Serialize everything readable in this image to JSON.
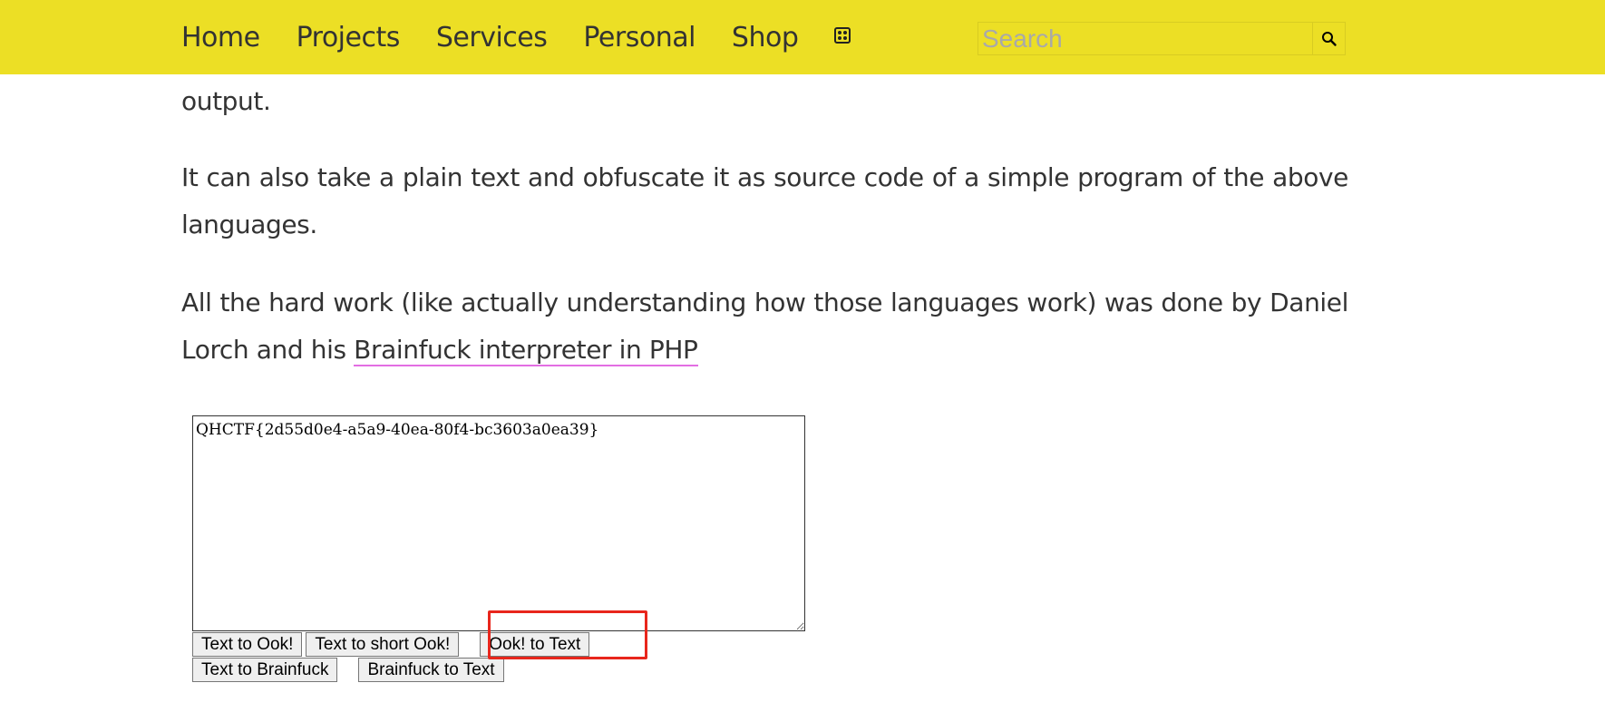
{
  "nav": {
    "items": [
      "Home",
      "Projects",
      "Services",
      "Personal",
      "Shop"
    ],
    "random_icon": "dice-icon"
  },
  "search": {
    "placeholder": "Search",
    "value": "",
    "button_icon": "search-icon"
  },
  "content": {
    "p1": "output.",
    "p2": "It can also take a plain text and obfuscate it as source code of a simple program of the above languages.",
    "p3_text": "All the hard work (like actually understanding how those languages work) was done by Daniel Lorch and his ",
    "p3_link": "Brainfuck interpreter in PHP"
  },
  "tool": {
    "textarea_value": "QHCTF{2d55d0e4-a5a9-40ea-80f4-bc3603a0ea39}",
    "buttons_row1": [
      "Text to Ook!",
      "Text to short Ook!",
      "Ook! to Text"
    ],
    "buttons_row2": [
      "Text to Brainfuck",
      "Brainfuck to Text"
    ]
  },
  "colors": {
    "topbar": "#ecdf25",
    "link_underline": "#e36ee3",
    "highlight": "#e8261c"
  }
}
